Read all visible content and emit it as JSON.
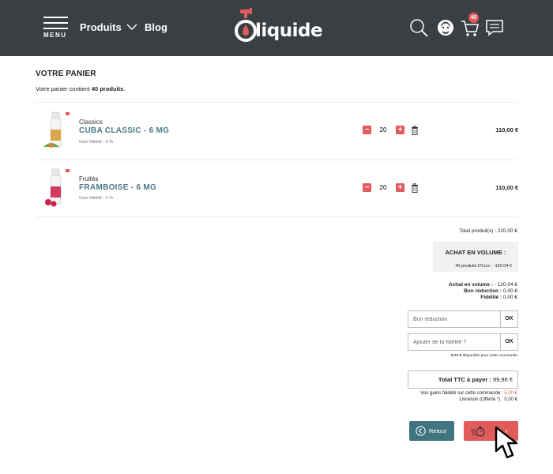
{
  "header": {
    "menu_label": "MENU",
    "nav_produits": "Produits",
    "nav_blog": "Blog",
    "logo_text": "liquide",
    "cart_count": "40"
  },
  "cart": {
    "title": "VOTRE PANIER",
    "subtitle_prefix": "Votre panier contient ",
    "subtitle_count": "40 produits",
    "subtitle_suffix": "."
  },
  "products": [
    {
      "category": "Classics",
      "name": "CUBA CLASSIC - 6 MG",
      "gain": "Gain fidélité : 5 %",
      "quantity": "20",
      "price": "110,00 €",
      "bottle_color": "#d8a84a",
      "fruit_color": "#6aa84f"
    },
    {
      "category": "Fruités",
      "name": "FRAMBOISE - 6 MG",
      "gain": "Gain fidélité : 5 %",
      "quantity": "20",
      "price": "110,00 €",
      "bottle_color": "#d23a5e",
      "fruit_color": "#c8234a"
    }
  ],
  "summary": {
    "total_produits": "Total produit(s) : 220,00 €",
    "volume_title": "ACHAT EN VOLUME :",
    "volume_sub": "40 produits D'Lice : -120.04 €",
    "line1_label": "Achat en volume : ",
    "line1_value": "- 120,04 €",
    "line2_label": "Bon réduction : ",
    "line2_value": "0,00 €",
    "line3_label": "Fidélité : ",
    "line3_value": "0,00 €",
    "coupon_placeholder": "Bon réduction",
    "fidelity_placeholder": "Ajouter de la fidélité ?",
    "ok_label": "OK",
    "dispo_value": "0,71 €",
    "dispo_text": " disponible pour cette commande",
    "total_ttc_label": "Total TTC à payer : ",
    "total_ttc_value": "99,96 €",
    "gains_label": "Vos gains fidélité sur cette commande : ",
    "gains_value": "5,00 €",
    "livraison": "Livraison (Offerte *) : 0,00 €"
  },
  "buttons": {
    "retour": "Retour",
    "commander_partial": "r"
  },
  "colors": {
    "header_bg": "#3a3f44",
    "accent_red": "#e15b5b",
    "teal": "#3f7480",
    "product_name": "#4a7a86"
  },
  "icons": [
    "menu-icon",
    "chevron-down-icon",
    "search-icon",
    "account-icon",
    "cart-icon",
    "chat-icon",
    "trash-icon",
    "arrow-left-icon",
    "stopwatch-icon",
    "mouse-pointer-icon"
  ]
}
